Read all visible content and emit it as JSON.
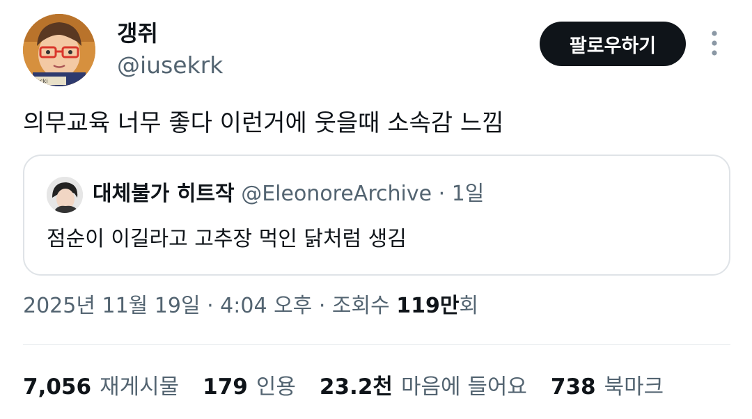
{
  "author": {
    "name": "갱쥐",
    "handle": "@iusekrk",
    "avatar_caption": "e facki"
  },
  "follow_label": "팔로우하기",
  "tweet": {
    "text": "의무교육 너무 좋다 이런거에 웃을때 소속감 느낌"
  },
  "quote": {
    "name": "대체불가 히트작",
    "handle": "@EleonoreArchive",
    "separator": "·",
    "time": "1일",
    "text": "점순이 이길라고 고추장 먹인 닭처럼 생김"
  },
  "meta": {
    "datetime": "2025년 11월 19일 · 4:04 오후 · 조회수 ",
    "views_number": "119만",
    "views_suffix": "회"
  },
  "stats": [
    {
      "number": "7,056",
      "label": "재게시물"
    },
    {
      "number": "179",
      "label": "인용"
    },
    {
      "number": "23.2천",
      "label": "마음에 들어요"
    },
    {
      "number": "738",
      "label": "북마크"
    }
  ],
  "colors": {
    "text": "#0f1419",
    "secondary": "#536471",
    "follow_bg": "#0f1419",
    "border": "#dfe3e7"
  },
  "icons": [
    "more-icon"
  ]
}
